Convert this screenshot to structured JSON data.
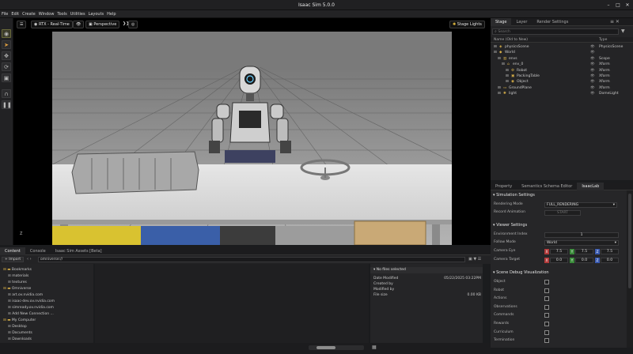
{
  "window": {
    "title": "Isaac Sim 5.0.0"
  },
  "menu": [
    "File",
    "Edit",
    "Create",
    "Window",
    "Tools",
    "Utilities",
    "Layouts",
    "Help"
  ],
  "viewport": {
    "render_mode": "RTX - Real-Time",
    "camera": "Perspective",
    "lights": "Stage Lights",
    "axis_label": "Z"
  },
  "right_tabs": [
    "Stage",
    "Layer",
    "Render Settings"
  ],
  "stage": {
    "search_placeholder": "Search",
    "col_name": "Name (Old to New)",
    "col_type": "Type",
    "rows": [
      {
        "name": "physicsScene",
        "type": "PhysicsScene",
        "indent": 0
      },
      {
        "name": "World",
        "type": "",
        "indent": 0
      },
      {
        "name": "envs",
        "type": "Scope",
        "indent": 1
      },
      {
        "name": "env_0",
        "type": "Xform",
        "indent": 2
      },
      {
        "name": "Robot",
        "type": "Xform",
        "indent": 3
      },
      {
        "name": "PackingTable",
        "type": "Xform",
        "indent": 3
      },
      {
        "name": "Object",
        "type": "Xform",
        "indent": 3
      },
      {
        "name": "GroundPlane",
        "type": "Xform",
        "indent": 1
      },
      {
        "name": "light",
        "type": "DomeLight",
        "indent": 1
      }
    ]
  },
  "props_tabs": [
    "Property",
    "Semantics Schema Editor",
    "IsaacLab"
  ],
  "props": {
    "sim_section": "Simulation Settings",
    "rendering_mode_label": "Rendering Mode",
    "rendering_mode_value": "FULL_RENDERING",
    "record_label": "Record Animation",
    "record_button": "START",
    "viewer_section": "Viewer Settings",
    "env_index_label": "Environment Index",
    "env_index_value": "1",
    "follow_label": "Follow Mode",
    "follow_value": "World",
    "eye_label": "Camera Eye",
    "eye": [
      "7.5",
      "7.5",
      "7.5"
    ],
    "target_label": "Camera Target",
    "target": [
      "0.0",
      "0.0",
      "0.0"
    ],
    "axes": [
      "X",
      "Y",
      "Z"
    ],
    "debug_section": "Scene Debug Visualization",
    "debug_items": [
      "Object",
      "Robot",
      "Actions",
      "Observations",
      "Commands",
      "Rewards",
      "Curriculum",
      "Termination"
    ]
  },
  "bottom_tabs": [
    "Content",
    "Console",
    "Isaac Sim Assets [Beta]"
  ],
  "content": {
    "import_label": "Import",
    "path": "omniverse://",
    "tree": [
      {
        "label": "Bookmarks",
        "indent": 0
      },
      {
        "label": "materials",
        "indent": 1
      },
      {
        "label": "textures",
        "indent": 1
      },
      {
        "label": "Omniverse",
        "indent": 0
      },
      {
        "label": "art.ov.nvidia.com",
        "indent": 1
      },
      {
        "label": "isaac-dev.ov.nvidia.com",
        "indent": 1
      },
      {
        "label": "simready.ov.nvidia.com",
        "indent": 1
      },
      {
        "label": "Add New Connection ...",
        "indent": 1
      },
      {
        "label": "My Computer",
        "indent": 0
      },
      {
        "label": "Desktop",
        "indent": 1
      },
      {
        "label": "Documents",
        "indent": 1
      },
      {
        "label": "Downloads",
        "indent": 1
      }
    ],
    "info_title": "No files selected",
    "info": [
      {
        "k": "Date Modified",
        "v": "05/22/2025 03:22PM"
      },
      {
        "k": "Created by",
        "v": ""
      },
      {
        "k": "Modified by",
        "v": ""
      },
      {
        "k": "File size",
        "v": "0.00 KB"
      }
    ]
  },
  "colors": {
    "accent": "#76b900",
    "panel": "#242426"
  }
}
